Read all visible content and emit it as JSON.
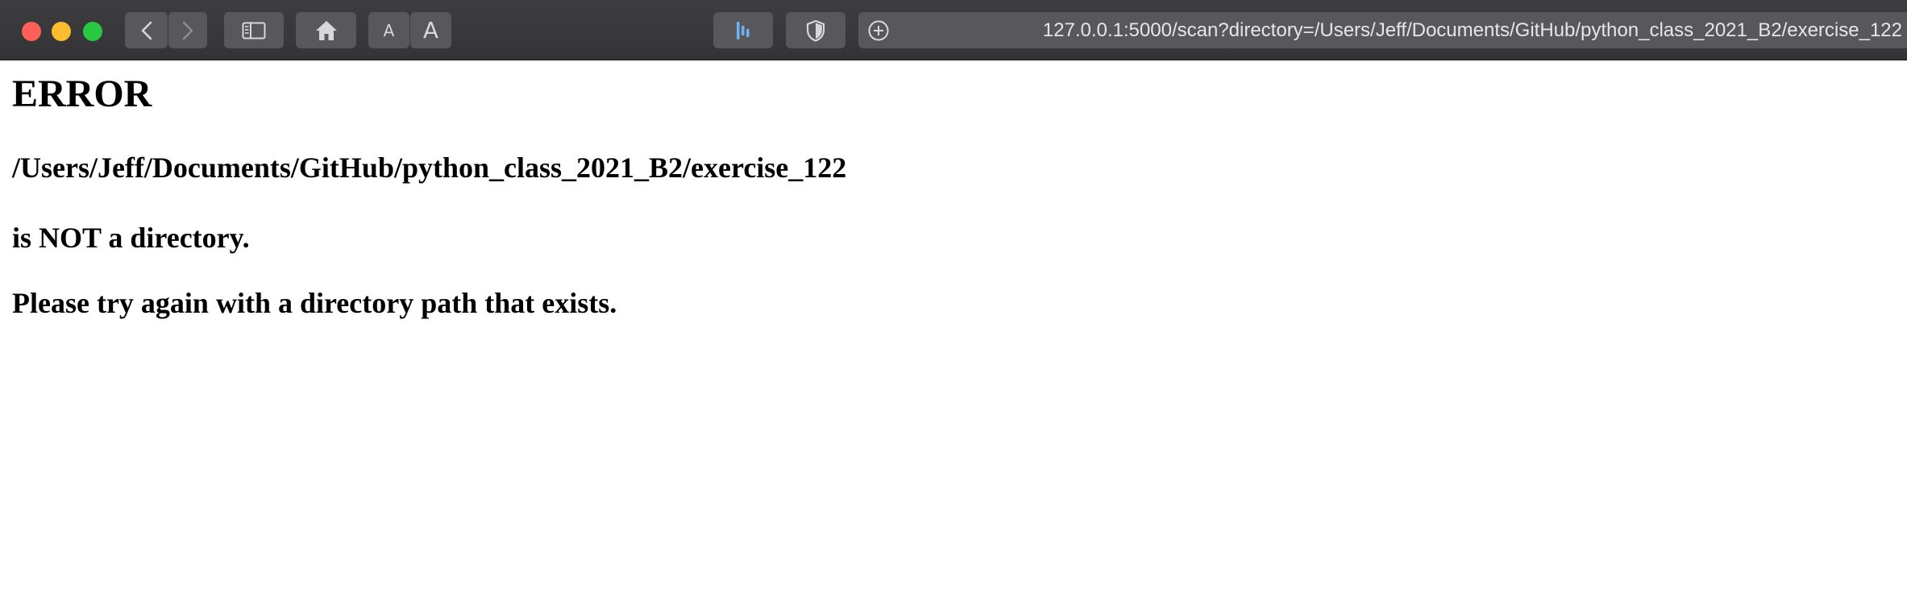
{
  "browser": {
    "url": "127.0.0.1:5000/scan?directory=/Users/Jeff/Documents/GitHub/python_class_2021_B2/exercise_122",
    "font_small_label": "A",
    "font_large_label": "A"
  },
  "page": {
    "heading": "ERROR",
    "path": "/Users/Jeff/Documents/GitHub/python_class_2021_B2/exercise_122",
    "message": "is NOT a directory.",
    "instruction": "Please try again with a directory path that exists."
  },
  "colors": {
    "close": "#fe5f57",
    "minimize": "#febc2e",
    "zoom": "#28c840",
    "toolbar": "#3d3d40",
    "extension_accent": "#6fb3f0"
  }
}
